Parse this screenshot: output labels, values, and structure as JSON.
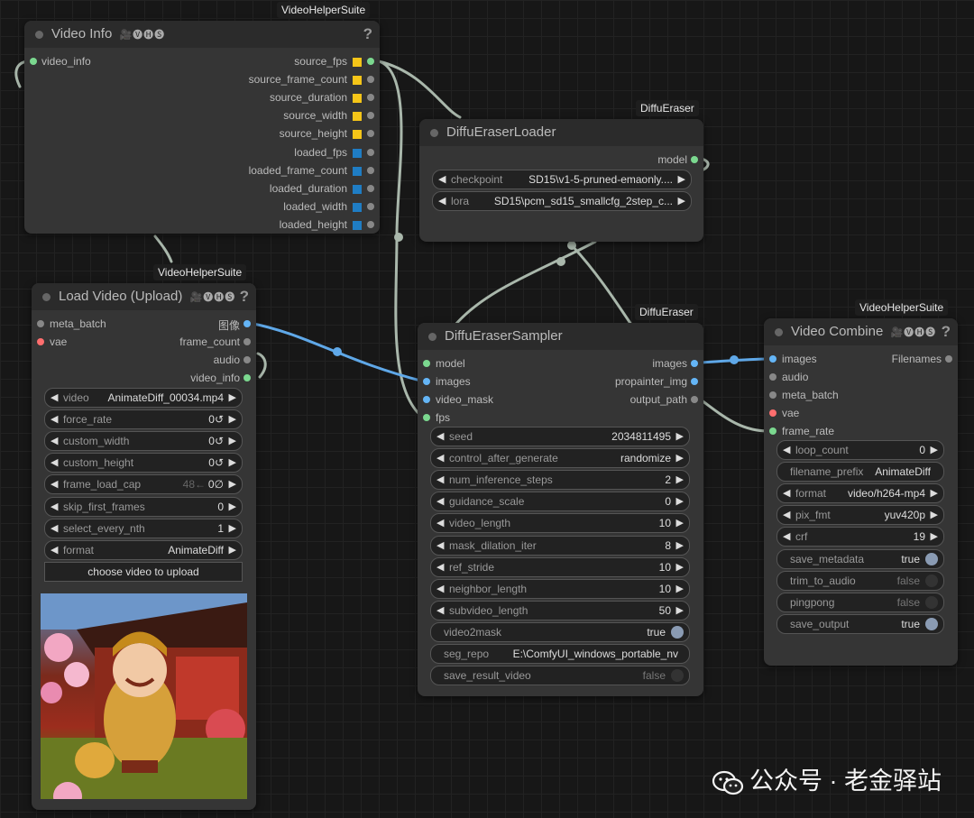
{
  "video_info": {
    "tag": "VideoHelperSuite",
    "title": "Video Info",
    "badges": "🎥🅥🅗🅢",
    "help": "?",
    "inputs": [
      "video_info"
    ],
    "outputs": [
      "source_fps",
      "source_frame_count",
      "source_duration",
      "source_width",
      "source_height",
      "loaded_fps",
      "loaded_frame_count",
      "loaded_duration",
      "loaded_width",
      "loaded_height"
    ]
  },
  "load_video": {
    "tag": "VideoHelperSuite",
    "title": "Load Video (Upload)",
    "badges": "🎥🅥🅗🅢",
    "help": "?",
    "inputs": [
      "meta_batch",
      "vae"
    ],
    "outputs": [
      "图像",
      "frame_count",
      "audio",
      "video_info"
    ],
    "widgets": [
      {
        "label": "video",
        "value": "AnimateDiff_00034.mp4"
      },
      {
        "label": "force_rate",
        "value": "0↺"
      },
      {
        "label": "custom_width",
        "value": "0↺"
      },
      {
        "label": "custom_height",
        "value": "0↺"
      },
      {
        "label": "frame_load_cap",
        "value": "0∅",
        "hint": "48←"
      },
      {
        "label": "skip_first_frames",
        "value": "0"
      },
      {
        "label": "select_every_nth",
        "value": "1"
      },
      {
        "label": "format",
        "value": "AnimateDiff"
      }
    ],
    "upload_button": "choose video to upload"
  },
  "loader": {
    "tag": "DiffuEraser",
    "title": "DiffuEraserLoader",
    "outputs": [
      "model"
    ],
    "widgets": [
      {
        "label": "checkpoint",
        "value": "SD15\\v1-5-pruned-emaonly...."
      },
      {
        "label": "lora",
        "value": "SD15\\pcm_sd15_smallcfg_2step_c..."
      }
    ]
  },
  "sampler": {
    "tag": "DiffuEraser",
    "title": "DiffuEraserSampler",
    "inputs": [
      "model",
      "images",
      "video_mask",
      "fps"
    ],
    "outputs": [
      "images",
      "propainter_img",
      "output_path"
    ],
    "widgets": [
      {
        "label": "seed",
        "value": "2034811495"
      },
      {
        "label": "control_after_generate",
        "value": "randomize"
      },
      {
        "label": "num_inference_steps",
        "value": "2"
      },
      {
        "label": "guidance_scale",
        "value": "0"
      },
      {
        "label": "video_length",
        "value": "10"
      },
      {
        "label": "mask_dilation_iter",
        "value": "8"
      },
      {
        "label": "ref_stride",
        "value": "10"
      },
      {
        "label": "neighbor_length",
        "value": "10"
      },
      {
        "label": "subvideo_length",
        "value": "50"
      }
    ],
    "toggles": [
      {
        "label": "video2mask",
        "value": "true",
        "on": true
      },
      {
        "label": "seg_repo",
        "value": "E:\\ComfyUI_windows_portable_nv",
        "text": true
      },
      {
        "label": "save_result_video",
        "value": "false",
        "on": false
      }
    ]
  },
  "combine": {
    "tag": "VideoHelperSuite",
    "title": "Video Combine",
    "badges": "🎥🅥🅗🅢",
    "help": "?",
    "inputs": [
      "images",
      "audio",
      "meta_batch",
      "vae",
      "frame_rate"
    ],
    "outputs": [
      "Filenames"
    ],
    "widgets": [
      {
        "label": "loop_count",
        "value": "0",
        "arrows": true
      },
      {
        "label": "filename_prefix",
        "value": "AnimateDiff",
        "arrows": false
      },
      {
        "label": "format",
        "value": "video/h264-mp4",
        "arrows": true
      },
      {
        "label": "pix_fmt",
        "value": "yuv420p",
        "arrows": true
      },
      {
        "label": "crf",
        "value": "19",
        "arrows": true
      }
    ],
    "toggles": [
      {
        "label": "save_metadata",
        "value": "true",
        "on": true
      },
      {
        "label": "trim_to_audio",
        "value": "false",
        "on": false
      },
      {
        "label": "pingpong",
        "value": "false",
        "on": false
      },
      {
        "label": "save_output",
        "value": "true",
        "on": true
      }
    ]
  },
  "watermark": "公众号 · 老金驿站",
  "colors": {
    "int": "#f5c518",
    "float": "#1f7dc4",
    "image": "#64b5f6",
    "model": "#7bd88f",
    "vae": "#ff6e6e",
    "wire": "#a9b7ab",
    "wire_image": "#5fa8e8"
  }
}
